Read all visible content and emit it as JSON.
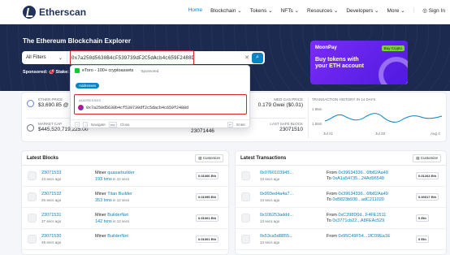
{
  "nav": {
    "brand": "Etherscan",
    "links": [
      "Home",
      "Blockchain ⌄",
      "Tokens ⌄",
      "NFTs ⌄",
      "Resources ⌄",
      "Developers ⌄",
      "More ⌄",
      "Sign In"
    ]
  },
  "hero": {
    "title": "The Ethereum Blockchain Explorer",
    "filter": "All Filters",
    "search_value": "0x7a250d5630B4cF539739dF2C5dAcb4c659F2488D",
    "sponsored_label": "Sponsored:",
    "sponsored_text": "Stake:"
  },
  "ad": {
    "brand": "MoonPay",
    "button": "Buy Crypto",
    "headline_1": "Buy tokens with",
    "headline_2": "your ETH account"
  },
  "dropdown": {
    "ad_text": "eToro - 100+ cryptoassets",
    "ad_tag": "Sponsored",
    "pill": "Addresses",
    "section_label": "ADDRESSES",
    "address": "0x7a250d5630b4cf539739df2c5dacb4c659f2488d",
    "footer_navigate": "Navigate",
    "footer_close_key": "esc",
    "footer_close": "Close",
    "footer_enter": "Enter"
  },
  "stats": {
    "ether_price_label": "ETHER PRICE",
    "ether_price": "$3,690.85 @",
    "market_cap_label": "MARKET CAP",
    "market_cap": "$445,520,719,225.00",
    "med_gas_label": "MED GAS PRICE",
    "med_gas": "0.179 Gwei ($0.01)",
    "last_safe_label": "LAST SAFE BLOCK",
    "last_safe": "23071510",
    "middle_value": "23071446",
    "history_label": "TRANSACTION HISTORY IN 14 DAYS",
    "y_top": "1.95m",
    "y_bottom": "1.55m",
    "x_labels": [
      "Jul 21",
      "Jul 28",
      "Aug 4"
    ]
  },
  "blocks": {
    "title": "Latest Blocks",
    "customize": "Customize",
    "rows": [
      {
        "num": "23071533",
        "age": "13 secs ago",
        "miner_label": "Miner",
        "miner": "quasarbuilder",
        "txns": "193 txns",
        "txns_time": "in 12 secs",
        "reward": "0.01006 Eth"
      },
      {
        "num": "23071532",
        "age": "25 secs ago",
        "miner_label": "Miner",
        "miner": "Titan Builder",
        "txns": "353 txns",
        "txns_time": "in 12 secs",
        "reward": "0.01095 Eth"
      },
      {
        "num": "23071531",
        "age": "37 secs ago",
        "miner_label": "Miner",
        "miner": "BuilderNet",
        "txns": "142 txns",
        "txns_time": "in 12 secs",
        "reward": "0.01001 Eth"
      },
      {
        "num": "23071530",
        "age": "49 secs ago",
        "miner_label": "Miner",
        "miner": "BuilderNet",
        "txns": "",
        "txns_time": "",
        "reward": "0.01001 Eth"
      }
    ]
  },
  "transactions": {
    "title": "Latest Transactions",
    "customize": "Customize",
    "rows": [
      {
        "hash": "0x0760103945...",
        "age": "13 secs ago",
        "from": "0x39634336...6fb82Aa49",
        "to": "0xA1a54735...24Ad96548",
        "amount": "0.01263 Eth"
      },
      {
        "hash": "0x993ed4a4a7...",
        "age": "13 secs ago",
        "from": "0x39634336...6fb82Aa49",
        "to": "0xB823b930...adC211020",
        "amount": "0.00017 Eth"
      },
      {
        "hash": "0x106253addd...",
        "age": "13 secs ago",
        "from": "0xC398D0d...F4FE1511",
        "to": "0x3771cb22...A8FEAc529",
        "amount": "0 Eth"
      },
      {
        "hash": "0x53ca5d8855...",
        "age": "13 secs ago",
        "from": "0x95C49F54...1fC09Ea1E",
        "to": "",
        "amount": "0 Eth"
      }
    ]
  }
}
